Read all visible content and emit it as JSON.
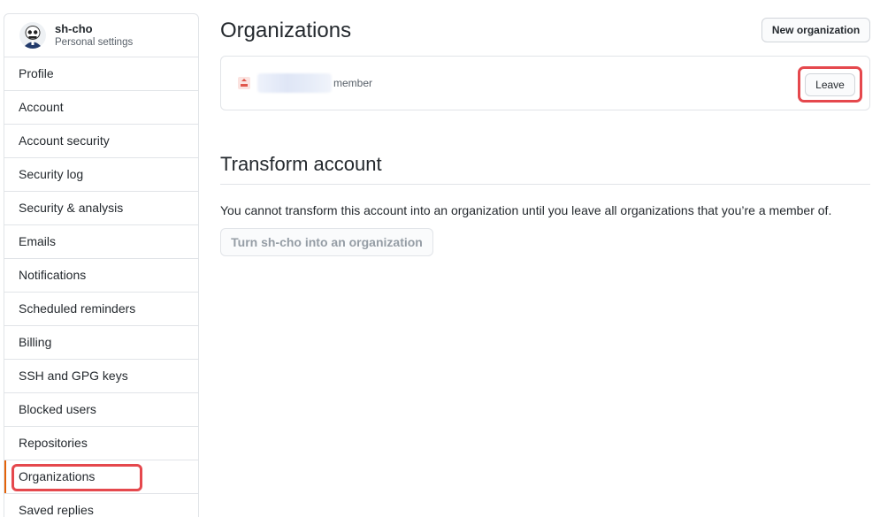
{
  "sidebar": {
    "username": "sh-cho",
    "subtitle": "Personal settings",
    "items": [
      {
        "label": "Profile"
      },
      {
        "label": "Account"
      },
      {
        "label": "Account security"
      },
      {
        "label": "Security log"
      },
      {
        "label": "Security & analysis"
      },
      {
        "label": "Emails"
      },
      {
        "label": "Notifications"
      },
      {
        "label": "Scheduled reminders"
      },
      {
        "label": "Billing"
      },
      {
        "label": "SSH and GPG keys"
      },
      {
        "label": "Blocked users"
      },
      {
        "label": "Repositories"
      },
      {
        "label": "Organizations",
        "selected": true
      },
      {
        "label": "Saved replies"
      }
    ]
  },
  "main": {
    "title": "Organizations",
    "new_org_label": "New organization",
    "org": {
      "role": "member",
      "leave_label": "Leave"
    },
    "transform": {
      "heading": "Transform account",
      "description": "You cannot transform this account into an organization until you leave all organizations that you’re a member of.",
      "button_label": "Turn sh-cho into an organization"
    }
  },
  "colors": {
    "accent_selected": "#e36209",
    "highlight": "#e5484d",
    "border": "#e1e4e8"
  }
}
